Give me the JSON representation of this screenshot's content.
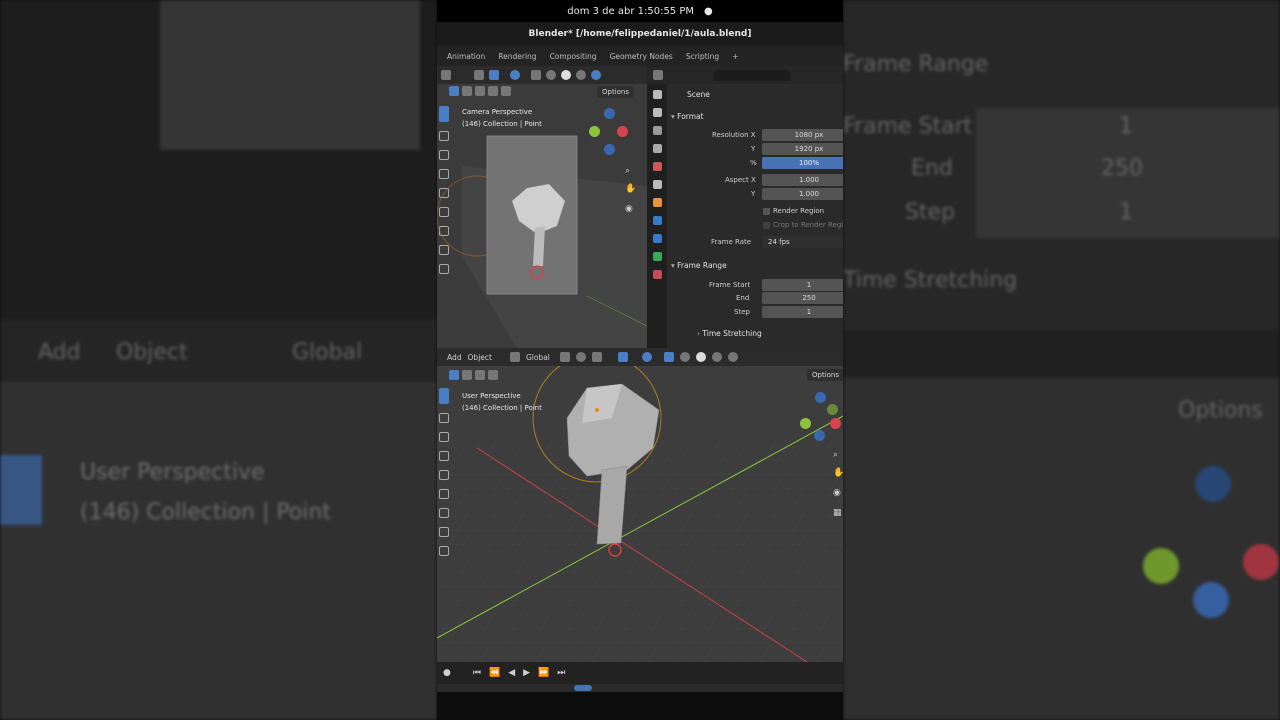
{
  "status_bar": {
    "datetime": "dom 3 de abr   1:50:55 PM",
    "dot": "●"
  },
  "window": {
    "title": "Blender* [/home/felippedaniel/1/aula.blend]"
  },
  "workspace_tabs": [
    "Animation",
    "Rendering",
    "Compositing",
    "Geometry Nodes",
    "Scripting",
    "+"
  ],
  "camera_viewport": {
    "options_label": "Options",
    "view_name": "Camera Perspective",
    "collection": "(146) Collection | Point"
  },
  "properties": {
    "context": "Scene",
    "format": {
      "section": "Format",
      "resolution_x_label": "Resolution X",
      "resolution_x": "1080 px",
      "y_label": "Y",
      "resolution_y": "1920 px",
      "pct_label": "%",
      "resolution_pct": "100%",
      "aspect_x_label": "Aspect X",
      "aspect_x": "1.000",
      "aspect_y_label": "Y",
      "aspect_y": "1.000",
      "render_region": "Render Region",
      "crop_region": "Crop to Render Region",
      "frame_rate_label": "Frame Rate",
      "frame_rate": "24 fps"
    },
    "frame_range": {
      "section": "Frame Range",
      "start_label": "Frame Start",
      "start": "1",
      "end_label": "End",
      "end": "250",
      "step_label": "Step",
      "step": "1",
      "time_stretching": "Time Stretching"
    }
  },
  "main_viewport": {
    "menu": [
      "Add",
      "Object"
    ],
    "orientation": "Global",
    "options_label": "Options",
    "view_name": "User Perspective",
    "collection": "(146) Collection | Point"
  },
  "timeline": {
    "controls": [
      "●",
      "⏮",
      "⏪",
      "◀",
      "▶",
      "⏩",
      "⏭"
    ]
  },
  "background": {
    "left": [
      "Add",
      "Object",
      "Global",
      "User Perspective",
      "(146) Collection | Point"
    ],
    "right": [
      "Frame Range",
      "Frame Start",
      "1",
      "End",
      "250",
      "Step",
      "1",
      "Time Stretching",
      "Options"
    ]
  },
  "colors": {
    "accent": "#4772b3",
    "x_axis": "#d8434f",
    "y_axis": "#8cc33c",
    "z_axis": "#4a7fd6"
  }
}
